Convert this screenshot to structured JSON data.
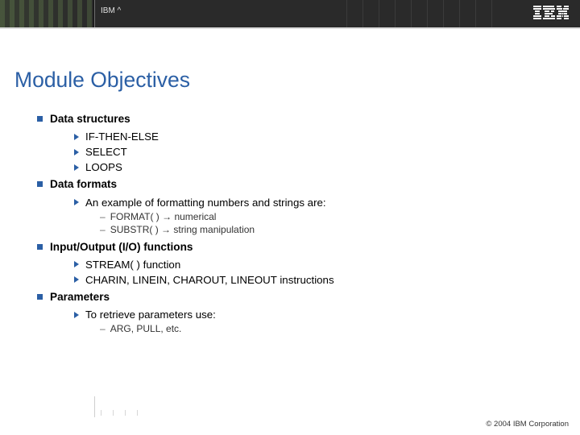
{
  "header": {
    "brand_label": "IBM ^",
    "logo_alt": "IBM"
  },
  "title": "Module Objectives",
  "sections": [
    {
      "title": "Data structures",
      "items": [
        {
          "text": "IF-THEN-ELSE"
        },
        {
          "text": "SELECT"
        },
        {
          "text": "LOOPS"
        }
      ]
    },
    {
      "title": "Data formats",
      "items": [
        {
          "text": "An example of formatting numbers and strings are:",
          "subitems": [
            "FORMAT( ) → numerical",
            "SUBSTR( ) → string manipulation"
          ]
        }
      ]
    },
    {
      "title": "Input/Output (I/O) functions",
      "items": [
        {
          "text": "STREAM( ) function"
        },
        {
          "text": "CHARIN, LINEIN, CHAROUT, LINEOUT instructions"
        }
      ]
    },
    {
      "title": "Parameters",
      "items": [
        {
          "text": "To retrieve parameters use:",
          "subitems": [
            "ARG, PULL, etc."
          ]
        }
      ]
    }
  ],
  "footer": {
    "copyright": "© 2004 IBM Corporation"
  }
}
